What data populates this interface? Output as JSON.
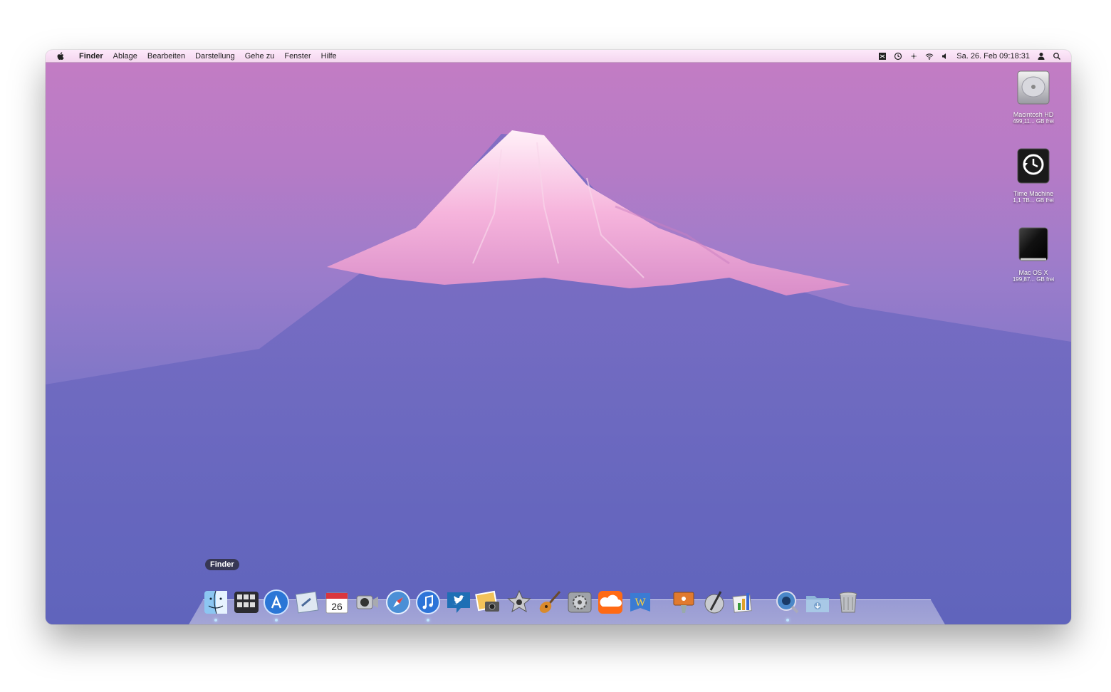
{
  "menubar": {
    "app_name": "Finder",
    "items": [
      "Ablage",
      "Bearbeiten",
      "Darstellung",
      "Gehe zu",
      "Fenster",
      "Hilfe"
    ],
    "clock": "Sa. 26. Feb  09:18:31"
  },
  "desktop_icons": [
    {
      "name": "Macintosh HD",
      "subtitle": "499,11... GB frei"
    },
    {
      "name": "Time Machine",
      "subtitle": "1,1 TB... GB frei"
    },
    {
      "name": "Mac OS X",
      "subtitle": "199,87... GB frei"
    }
  ],
  "dock": {
    "tooltip": "Finder",
    "calendar_day": "26",
    "apps": [
      "finder",
      "dashboard",
      "app-store",
      "mail",
      "ical",
      "facetime",
      "safari",
      "itunes",
      "twitter",
      "iphoto",
      "imovie",
      "garageband",
      "system-preferences",
      "soundcloud",
      "wunderlist",
      "keynote",
      "pages",
      "numbers",
      "quicktime",
      "downloads",
      "trash"
    ]
  },
  "colors": {
    "sky_top": "#c47cc4",
    "sky_bottom": "#6566bd",
    "snow": "#f2b2d8"
  }
}
